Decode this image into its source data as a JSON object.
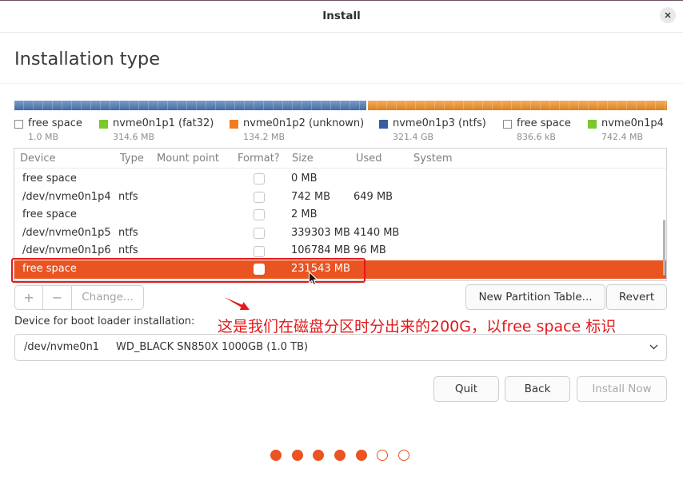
{
  "window": {
    "title": "Install"
  },
  "page": {
    "heading": "Installation type"
  },
  "theme": {
    "accent": "#e95420",
    "annotation": "#e3191c"
  },
  "icons": {
    "close": "close-icon",
    "dropdown": "chevron-down-icon",
    "pointer": "mouse-cursor-icon",
    "annotation_arrow": "arrow-icon"
  },
  "disk_bar": {
    "segments": [
      {
        "color": "#4a74b2",
        "share": 0.54
      },
      {
        "color": "#ee8c22",
        "share": 0.46
      }
    ]
  },
  "legend": [
    {
      "label": "free space",
      "size": "1.0 MB",
      "color": "#ffffff"
    },
    {
      "label": "nvme0n1p1 (fat32)",
      "size": "314.6 MB",
      "color": "#7bc82d"
    },
    {
      "label": "nvme0n1p2 (unknown)",
      "size": "134.2 MB",
      "color": "#f27b1f"
    },
    {
      "label": "nvme0n1p3 (ntfs)",
      "size": "321.4 GB",
      "color": "#365f9f"
    },
    {
      "label": "free space",
      "size": "836.6 kB",
      "color": "#ffffff"
    },
    {
      "label": "nvme0n1p4",
      "size": "742.4 MB",
      "color": "#7bc82d"
    }
  ],
  "partition_table": {
    "columns": {
      "device": "Device",
      "type": "Type",
      "mount_point": "Mount point",
      "format": "Format?",
      "size": "Size",
      "used": "Used",
      "system": "System"
    },
    "rows": [
      {
        "device": "free space",
        "size": "0 MB",
        "format": false
      },
      {
        "device": "/dev/nvme0n1p4",
        "type": "ntfs",
        "size": "742 MB",
        "used": "649 MB",
        "format": false
      },
      {
        "device": "free space",
        "size": "2 MB",
        "format": false
      },
      {
        "device": "/dev/nvme0n1p5",
        "type": "ntfs",
        "size": "339303 MB",
        "used": "4140 MB",
        "format": false
      },
      {
        "device": "/dev/nvme0n1p6",
        "type": "ntfs",
        "size": "106784 MB",
        "used": "96 MB",
        "format": false
      },
      {
        "device": "free space",
        "size": "231543 MB",
        "format": false,
        "selected": true
      }
    ]
  },
  "partition_actions": {
    "add": "+",
    "remove": "−",
    "change": "Change...",
    "new_table": "New Partition Table...",
    "revert": "Revert"
  },
  "boot_loader": {
    "label": "Device for boot loader installation:",
    "device": "/dev/nvme0n1",
    "description": "WD_BLACK SN850X 1000GB (1.0 TB)"
  },
  "footer": {
    "quit": "Quit",
    "back": "Back",
    "install_now": "Install Now"
  },
  "progress": {
    "total_steps": 7,
    "completed_steps": 5
  },
  "annotation": {
    "text": "这是我们在磁盘分区时分出来的200G，以free space 标识"
  }
}
